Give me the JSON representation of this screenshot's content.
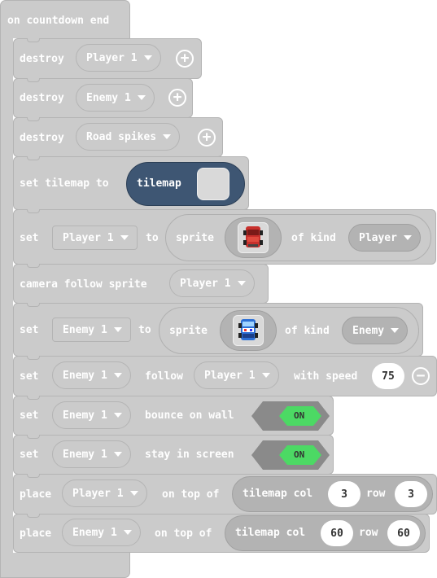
{
  "hat": {
    "label": "on countdown end"
  },
  "blocks": {
    "destroy_player": {
      "keyword": "destroy",
      "target": "Player 1"
    },
    "destroy_enemy": {
      "keyword": "destroy",
      "target": "Enemy 1"
    },
    "destroy_spikes": {
      "keyword": "destroy",
      "target": "Road spikes"
    },
    "set_tilemap": {
      "keyword": "set tilemap to",
      "value": "tilemap"
    },
    "set_player": {
      "keyword": "set",
      "variable": "Player 1",
      "to": "to",
      "sprite_label": "sprite",
      "of_kind": "of kind",
      "kind": "Player"
    },
    "camera": {
      "keyword": "camera follow sprite",
      "target": "Player 1"
    },
    "set_enemy": {
      "keyword": "set",
      "variable": "Enemy 1",
      "to": "to",
      "sprite_label": "sprite",
      "of_kind": "of kind",
      "kind": "Enemy"
    },
    "follow": {
      "keyword": "set",
      "sprite": "Enemy 1",
      "follow": "follow",
      "target": "Player 1",
      "with_speed": "with speed",
      "speed": "75"
    },
    "bounce": {
      "keyword": "set",
      "sprite": "Enemy 1",
      "flag": "bounce on wall",
      "state": "ON"
    },
    "stay": {
      "keyword": "set",
      "sprite": "Enemy 1",
      "flag": "stay in screen",
      "state": "ON"
    },
    "place_player": {
      "keyword": "place",
      "sprite": "Player 1",
      "on_top_of": "on top of",
      "tilemap_col": "tilemap col",
      "col": "3",
      "row_label": "row",
      "row": "3"
    },
    "place_enemy": {
      "keyword": "place",
      "sprite": "Enemy 1",
      "on_top_of": "on top of",
      "tilemap_col": "tilemap col",
      "col": "60",
      "row_label": "row",
      "row": "60"
    }
  },
  "icons": {
    "plus": "+",
    "minus": "−",
    "caret": "caret-down-icon",
    "player_sprite": "red-car-sprite",
    "enemy_sprite": "blue-police-car-sprite"
  },
  "colors": {
    "block": "#cbcbcb",
    "tilemap": "#3e5673",
    "toggle_on": "#4cd964"
  }
}
